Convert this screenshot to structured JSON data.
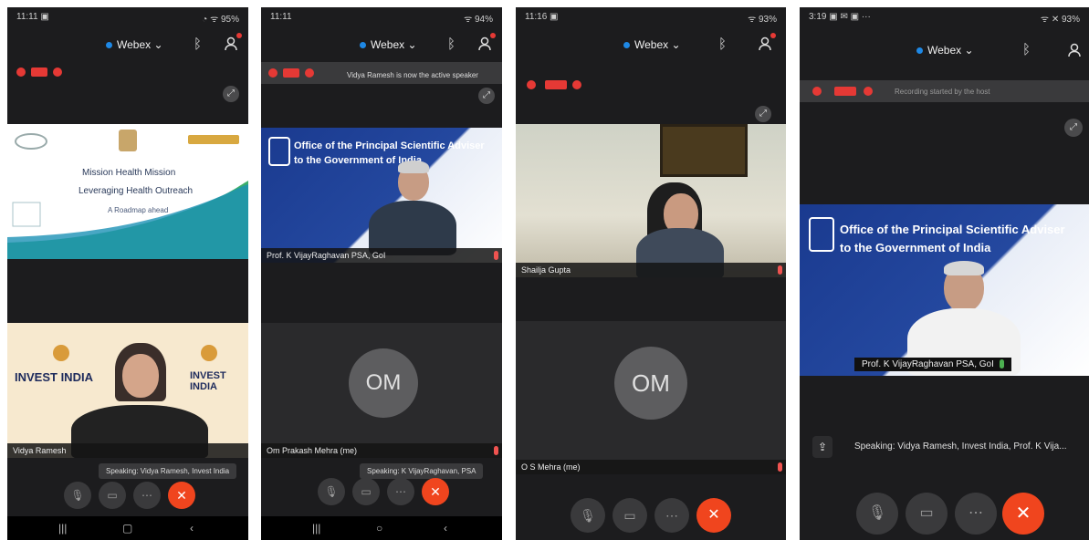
{
  "app": {
    "name": "Webex"
  },
  "colors": {
    "background": "#1c1c1e",
    "end_call": "#f0451e",
    "record": "#e53935",
    "webex_dot": "#1e88e5"
  },
  "icons": [
    "bluetooth-icon",
    "participants-icon",
    "record-icon",
    "expand-icon",
    "mute-icon",
    "video-icon",
    "more-icon",
    "end-call-icon",
    "share-icon"
  ],
  "screens": [
    {
      "status_left": "11:11 ▣",
      "status_right": "◔ ᯤ 95%",
      "webex_label": "Webex ⌄",
      "shared_slide": {
        "logo_left": "INVEST INDIA",
        "logo_right": "INVEST INDIA",
        "title": "Mission Health Mission",
        "subtitle": "Leveraging Health Outreach",
        "line3": "A Roadmap ahead"
      },
      "participant": {
        "left_logo": "INVEST INDIA",
        "right_logo": "INVEST INDIA",
        "name": "Vidya Ramesh"
      },
      "speaking": "Speaking: Vidya Ramesh, Invest India"
    },
    {
      "status_left": "11:11",
      "status_right": "ᯤ 94%",
      "webex_label": "Webex ⌄",
      "tooltip": "Vidya Ramesh is now the active speaker",
      "speaker": {
        "org_line1": "Office of the Principal Scientific Adviser",
        "org_line2": "to the Government of India",
        "name": "Prof. K VijayRaghavan PSA, GoI"
      },
      "avatar": {
        "initials": "OM",
        "name": "Om Prakash Mehra (me)"
      },
      "speaking": "Speaking: K VijayRaghavan, PSA"
    },
    {
      "status_left": "11:16 ▣",
      "status_right": "ᯤ 93%",
      "webex_label": "Webex ⌄",
      "speaker": {
        "name": "Shailja Gupta"
      },
      "avatar": {
        "initials": "OM",
        "name": "O S Mehra (me)"
      }
    },
    {
      "status_left": "3:19 ▣ ✉ ▣ ···",
      "status_right": "ᯤ ✕ 93%",
      "webex_label": "Webex ⌄",
      "rec_label": "Recording started by the host",
      "speaker": {
        "org_line1": "Office of the Principal Scientific Adviser",
        "org_line2": "to the Government of India",
        "name": "Prof. K VijayRaghavan PSA, GoI"
      },
      "speaking": "Speaking: Vidya Ramesh, Invest India, Prof. K Vija..."
    }
  ]
}
